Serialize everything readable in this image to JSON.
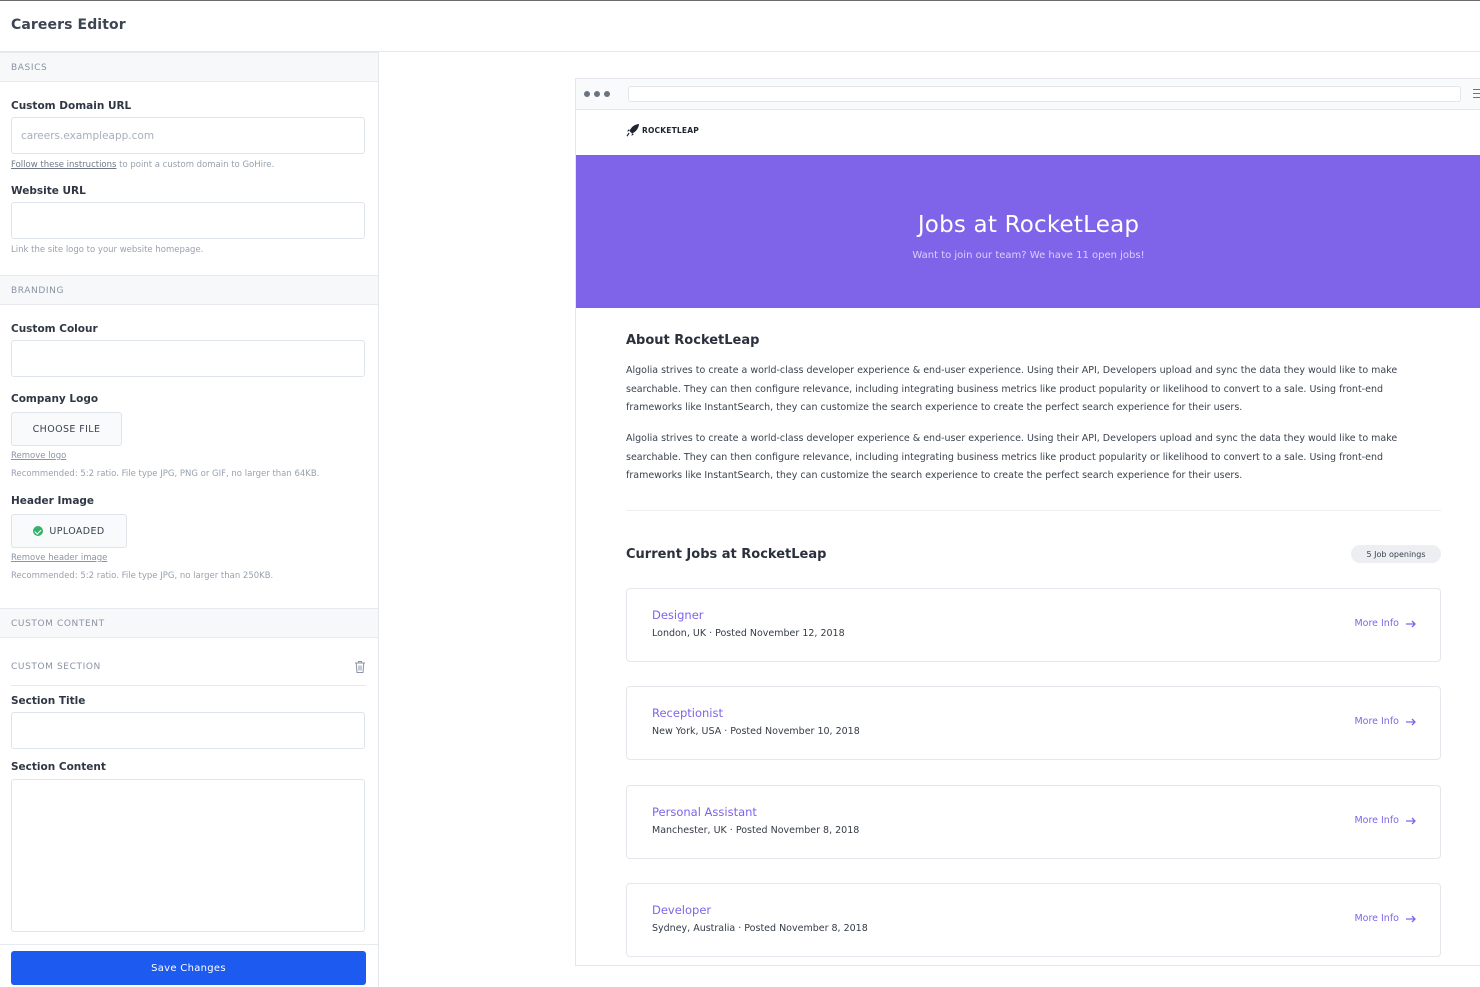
{
  "app": {
    "title": "Careers Editor"
  },
  "editor": {
    "basics": {
      "heading": "BASICS",
      "custom_domain": {
        "label": "Custom Domain URL",
        "placeholder": "careers.exampleapp.com",
        "help_link": "Follow these instructions",
        "help_text": " to point a custom domain to GoHire."
      },
      "website_url": {
        "label": "Website URL",
        "value": "",
        "help": "Link the site logo to your website homepage."
      }
    },
    "branding": {
      "heading": "BRANDING",
      "custom_colour": {
        "label": "Custom Colour",
        "value": ""
      },
      "company_logo": {
        "label": "Company Logo",
        "button": "CHOOSE FILE",
        "remove_link": "Remove logo",
        "help": "Recommended: 5:2 ratio. File type JPG, PNG or GIF, no larger than 64KB."
      },
      "header_image": {
        "label": "Header Image",
        "button": "UPLOADED",
        "remove_link": "Remove header image",
        "help": "Recommended: 5:2 ratio. File type JPG, no larger than 250KB."
      }
    },
    "custom_content": {
      "heading": "CUSTOM CONTENT",
      "section_heading": "CUSTOM SECTION",
      "section_title": {
        "label": "Section Title",
        "value": ""
      },
      "section_content": {
        "label": "Section Content",
        "value": ""
      }
    },
    "save_label": "Save Changes"
  },
  "preview": {
    "brand": "ROCKETLEAP",
    "hero": {
      "title": "Jobs at RocketLeap",
      "subtitle": "Want to join our team? We have 11 open jobs!"
    },
    "about": {
      "title": "About RocketLeap",
      "paragraphs": [
        "Algolia strives to create a world-class developer experience & end-user experience. Using their API, Developers upload and sync the data they would like to make searchable. They can then configure relevance, including integrating business metrics like product popularity or likelihood to convert to a sale. Using front-end frameworks like InstantSearch, they can customize the search experience to create the perfect search experience for their users.",
        "Algolia strives to create a world-class developer experience & end-user experience. Using their API, Developers upload and sync the data they would like to make searchable. They can then configure relevance, including integrating business metrics like product popularity or likelihood to convert to a sale. Using front-end frameworks like InstantSearch, they can customize the search experience to create the perfect search experience for their users."
      ]
    },
    "jobs": {
      "title": "Current Jobs at RocketLeap",
      "openings_badge": "5 Job openings",
      "more_info_label": "More Info",
      "items": [
        {
          "title": "Designer",
          "meta": "London, UK · Posted November 12, 2018"
        },
        {
          "title": "Receptionist",
          "meta": "New York, USA · Posted November 10, 2018"
        },
        {
          "title": "Personal Assistant",
          "meta": "Manchester, UK · Posted November 8, 2018"
        },
        {
          "title": "Developer",
          "meta": "Sydney, Australia · Posted November 8, 2018"
        }
      ]
    }
  },
  "colors": {
    "accent": "#7f64e9",
    "primary_button": "#1d5bf0",
    "success": "#33b369"
  },
  "icons": {
    "trash": "trash-icon",
    "check": "check-circle-icon",
    "arrow": "arrow-right-icon",
    "rocket": "rocket-icon",
    "menu": "hamburger-icon"
  }
}
